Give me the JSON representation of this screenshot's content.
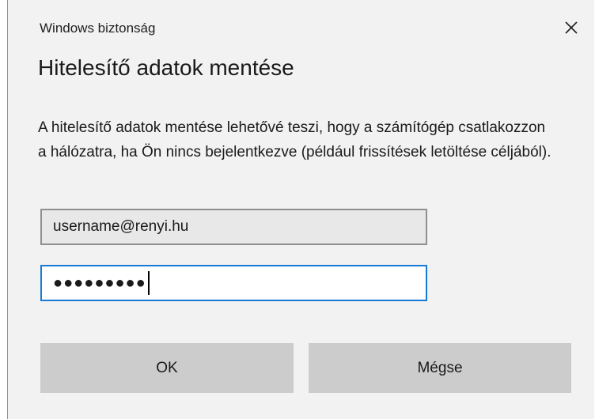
{
  "window": {
    "title": "Windows biztonság",
    "close_icon": "close-icon"
  },
  "dialog": {
    "heading": "Hitelesítő adatok mentése",
    "description": "A hitelesítő adatok mentése lehetővé teszi, hogy a számítógép csatlakozzon a hálózatra, ha Ön nincs bejelentkezve (például frissítések letöltése céljából)."
  },
  "fields": {
    "username_value": "username@renyi.hu",
    "password_masked": "●●●●●●●●●"
  },
  "buttons": {
    "ok_label": "OK",
    "cancel_label": "Mégse"
  },
  "colors": {
    "focus_border": "#1879d6",
    "dialog_bg": "#f2f2f2",
    "button_bg": "#cccccc"
  }
}
